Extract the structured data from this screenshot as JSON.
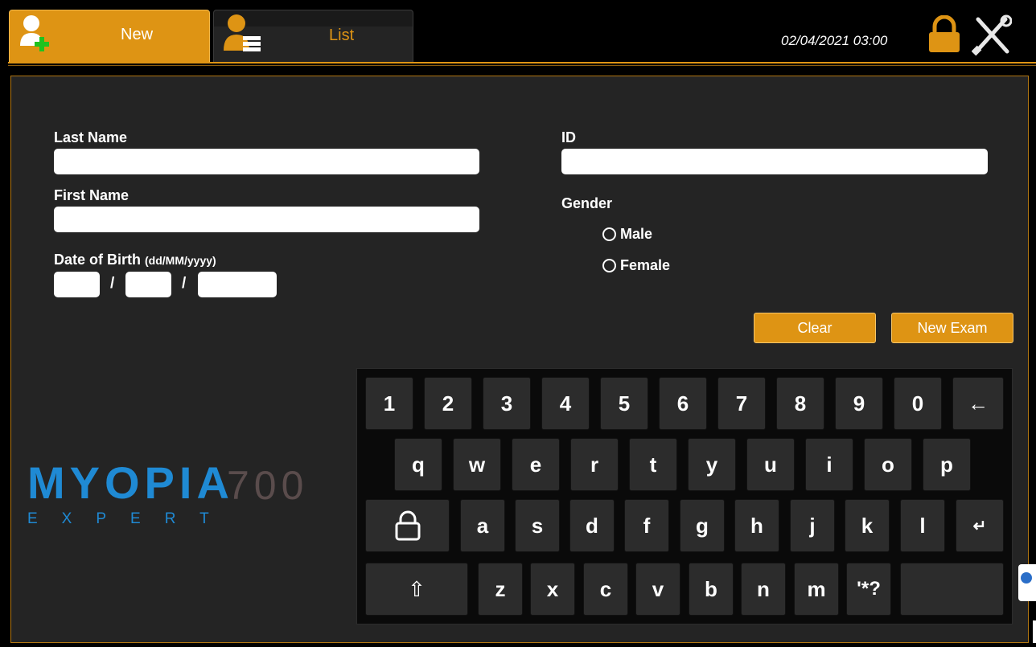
{
  "tabs": [
    {
      "label": "New",
      "icon": "add-user-icon",
      "active": true
    },
    {
      "label": "List",
      "icon": "user-list-icon",
      "active": false
    }
  ],
  "header": {
    "datetime": "02/04/2021 03:00",
    "lock_icon": "lock-icon",
    "tools_icon": "tools-icon"
  },
  "form": {
    "last_name_label": "Last Name",
    "first_name_label": "First Name",
    "dob_label": "Date of Birth",
    "dob_format": "(dd/MM/yyyy)",
    "id_label": "ID",
    "gender_label": "Gender",
    "male_label": "Male",
    "female_label": "Female",
    "slash": "/",
    "last_name_value": "",
    "first_name_value": "",
    "id_value": "",
    "dob_day": "",
    "dob_month": "",
    "dob_year": ""
  },
  "buttons": {
    "clear": "Clear",
    "new_exam": "New Exam"
  },
  "keyboard": {
    "row1": [
      "1",
      "2",
      "3",
      "4",
      "5",
      "6",
      "7",
      "8",
      "9",
      "0",
      "←"
    ],
    "row2": [
      "q",
      "w",
      "e",
      "r",
      "t",
      "y",
      "u",
      "i",
      "o",
      "p"
    ],
    "row3": [
      "a",
      "s",
      "d",
      "f",
      "g",
      "h",
      "j",
      "k",
      "l",
      "↵"
    ],
    "row4": [
      "⇧",
      "z",
      "x",
      "c",
      "v",
      "b",
      "n",
      "m",
      "'*?"
    ]
  },
  "logo": {
    "main": "MYOPIA",
    "model": "700",
    "sub": "EXPERT"
  },
  "colors": {
    "accent": "#de9414",
    "logo_blue": "#1f8ad4",
    "panel": "#242424"
  }
}
